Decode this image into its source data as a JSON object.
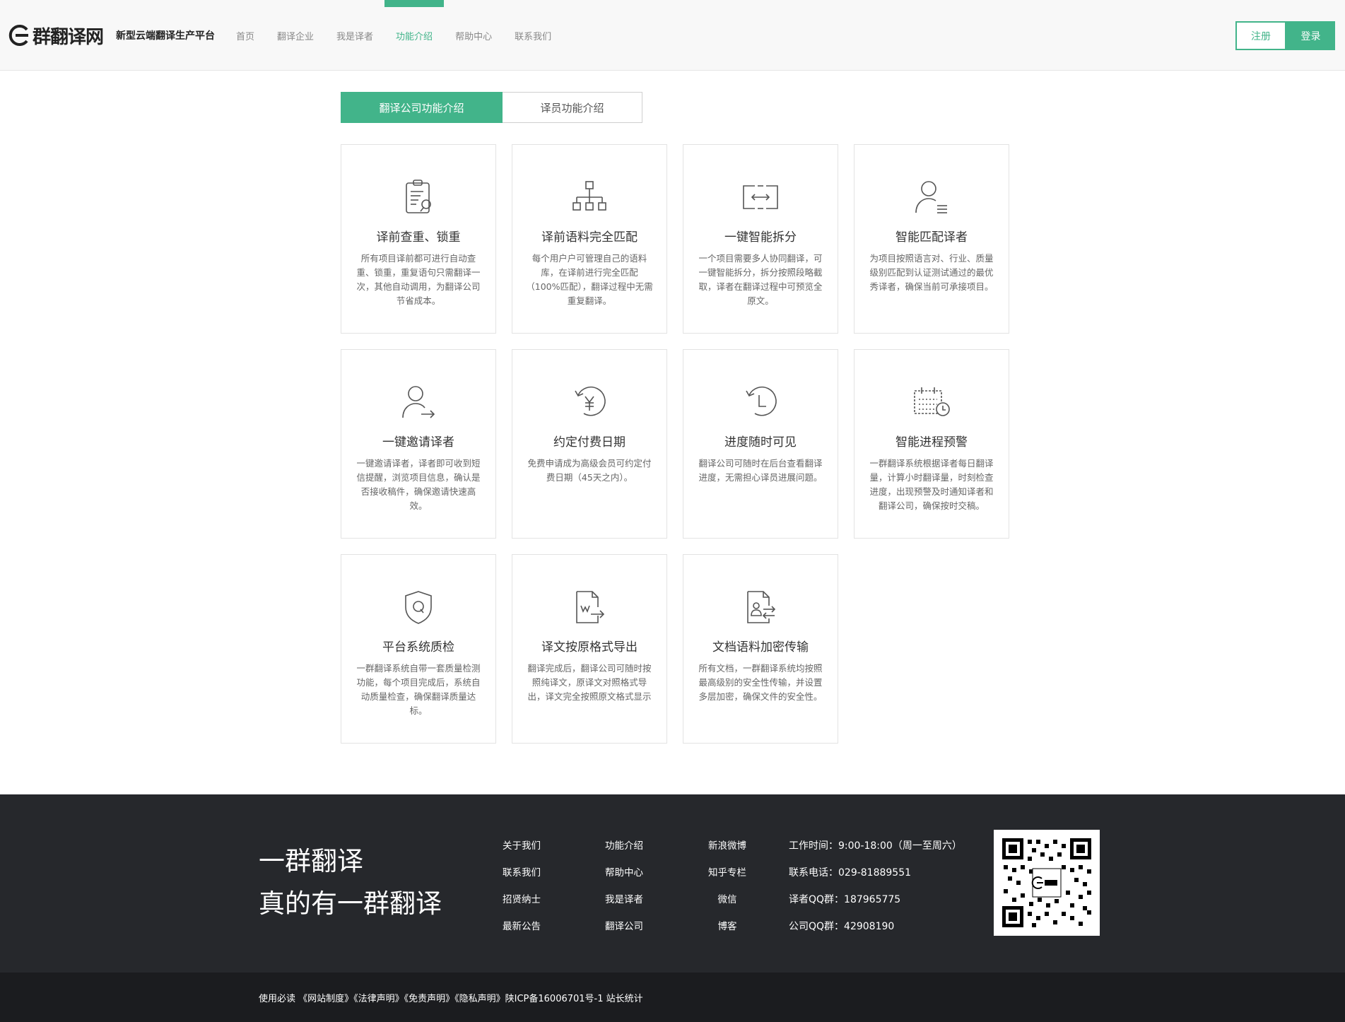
{
  "header": {
    "logo_text": "群翻译网",
    "slogan": "新型云端翻译生产平台",
    "nav": [
      {
        "label": "首页",
        "active": false
      },
      {
        "label": "翻译企业",
        "active": false
      },
      {
        "label": "我是译者",
        "active": false
      },
      {
        "label": "功能介绍",
        "active": true
      },
      {
        "label": "帮助中心",
        "active": false
      },
      {
        "label": "联系我们",
        "active": false
      }
    ],
    "register_label": "注册",
    "login_label": "登录"
  },
  "tabs": [
    {
      "label": "翻译公司功能介绍",
      "active": true
    },
    {
      "label": "译员功能介绍",
      "active": false
    }
  ],
  "features": [
    {
      "icon": "clipboard-check-icon",
      "title": "译前查重、锁重",
      "desc": "所有项目译前都可进行自动查重、锁重，重复语句只需翻译一次，其他自动调用，为翻译公司节省成本。"
    },
    {
      "icon": "org-chart-icon",
      "title": "译前语料完全匹配",
      "desc": "每个用户户可管理自己的语料库，在译前进行完全匹配（100%匹配），翻译过程中无需重复翻译。"
    },
    {
      "icon": "split-frame-icon",
      "title": "一键智能拆分",
      "desc": "一个项目需要多人协同翻译，可一键智能拆分，拆分按照段略截取，译者在翻译过程中可预览全原文。"
    },
    {
      "icon": "user-list-icon",
      "title": "智能匹配译者",
      "desc": "为项目按照语言对、行业、质量级别匹配到认证测试通过的最优秀译者，确保当前可承接项目。"
    },
    {
      "icon": "user-invite-icon",
      "title": "一键邀请译者",
      "desc": "一键邀请译者，译者即可收到短信提醒，浏览项目信息，确认是否接收稿件，确保邀请快速高效。"
    },
    {
      "icon": "yen-cycle-icon",
      "title": "约定付费日期",
      "desc": "免费申请成为高级会员可约定付费日期（45天之内）。"
    },
    {
      "icon": "clock-history-icon",
      "title": "进度随时可见",
      "desc": "翻译公司可随时在后台查看翻译进度，无需担心译员进展问题。"
    },
    {
      "icon": "calendar-alarm-icon",
      "title": "智能进程预警",
      "desc": "一群翻译系统根据译者每日翻译量，计算小时翻译量，时刻检查进度，出现预警及时通知译者和翻译公司，确保按时交稿。"
    },
    {
      "icon": "shield-q-icon",
      "title": "平台系统质检",
      "desc": "一群翻译系统自带一套质量检测功能，每个项目完成后，系统自动质量检查，确保翻译质量达标。"
    },
    {
      "icon": "doc-export-icon",
      "title": "译文按原格式导出",
      "desc": "翻译完成后，翻译公司可随时按照纯译文，原译文对照格式导出，译文完全按照原文格式显示"
    },
    {
      "icon": "doc-secure-icon",
      "title": "文档语料加密传输",
      "desc": "所有文档，一群翻译系统均按照最高级别的安全性传输，并设置多层加密，确保文件的安全性。"
    }
  ],
  "footer": {
    "slogan_line1": "一群翻译",
    "slogan_line2": "真的有一群翻译",
    "col1": [
      "关于我们",
      "联系我们",
      "招贤纳士",
      "最新公告"
    ],
    "col2": [
      "功能介绍",
      "帮助中心",
      "我是译者",
      "翻译公司"
    ],
    "col3": [
      "新浪微博",
      "知乎专栏",
      "微信",
      "博客"
    ],
    "contact": [
      "工作时间：9:00-18:00（周一至周六）",
      "联系电话：029-81889551",
      "译者QQ群：187965775",
      "公司QQ群：42908190"
    ],
    "bottom_text": "使用必读 《网站制度》《法律声明》《免责声明》《隐私声明》陕ICP备16006701号-1 站长统计"
  },
  "colors": {
    "accent": "#42b48a",
    "footer_bg": "#26282c",
    "bottom_bg": "#1b1c1f"
  }
}
